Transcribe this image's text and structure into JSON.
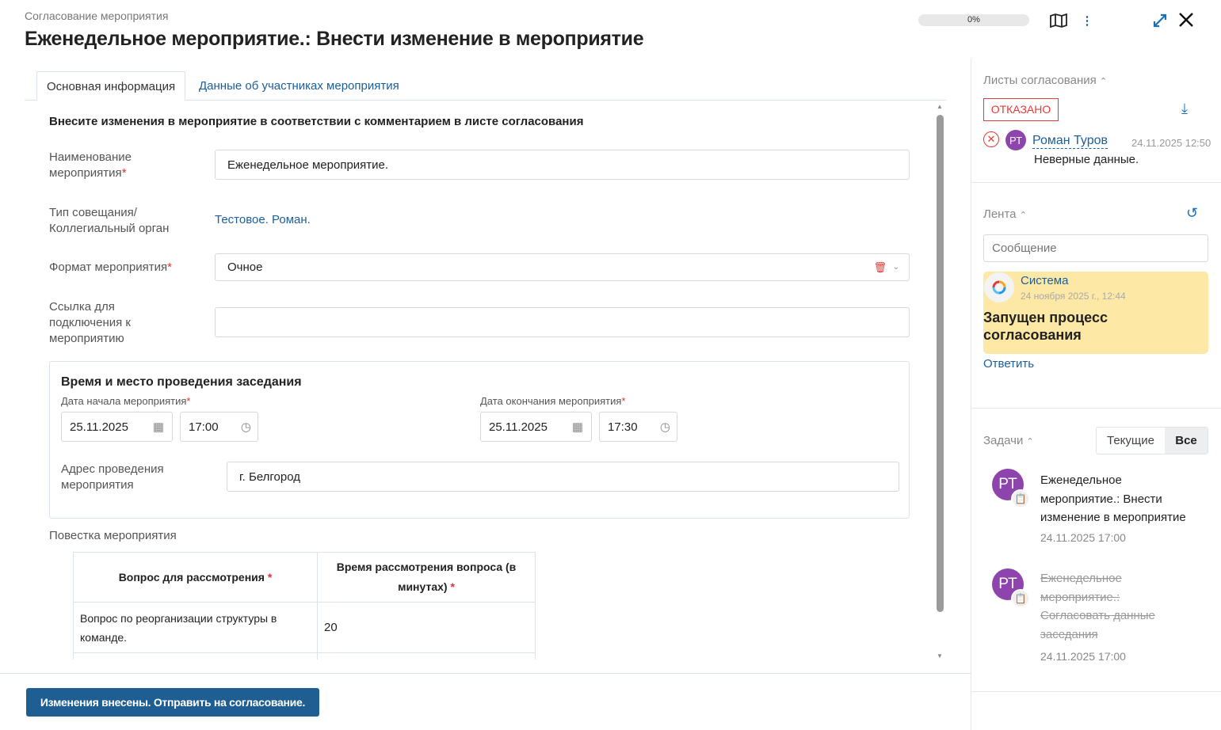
{
  "header": {
    "subtitle": "Согласование мероприятия",
    "title": "Еженедельное мероприятие.: Внести изменение в мероприятие",
    "progress": "0%"
  },
  "tabs": [
    {
      "label": "Основная информация"
    },
    {
      "label": "Данные об участниках мероприятия"
    }
  ],
  "form": {
    "instruction": "Внесите изменения в мероприятие в соответствии с комментарием в листе согласования",
    "name_label": "Наименование мероприятия",
    "name_value": "Еженедельное мероприятие.",
    "type_label": "Тип совещания/ Коллегиальный орган",
    "type_value": "Тестовое. Роман.",
    "format_label": "Формат мероприятия",
    "format_value": "Очное",
    "link_label": "Ссылка для подключения к мероприятию",
    "link_value": "",
    "time_section": "Время и место проведения заседания",
    "start_label": "Дата начала мероприятия",
    "start_date": "25.11.2025",
    "start_time": "17:00",
    "end_label": "Дата окончания мероприятия",
    "end_date": "25.11.2025",
    "end_time": "17:30",
    "address_label": "Адрес проведения мероприятия",
    "address_value": "г. Белгород",
    "agenda_label": "Повестка мероприятия",
    "agenda_headers": [
      "Вопрос для рассмотрения",
      "Время рассмотрения вопроса (в минутах)"
    ],
    "agenda_rows": [
      {
        "question": "Вопрос по реорганизации структуры в команде.",
        "minutes": "20"
      }
    ],
    "required_mark": "*"
  },
  "footer": {
    "submit": "Изменения внесены. Отправить на согласование."
  },
  "sidebar": {
    "approval": {
      "title": "Листы согласования",
      "status": "ОТКАЗАНО",
      "avatar": "РТ",
      "user": "Роман Туров",
      "date": "24.11.2025 12:50",
      "comment": "Неверные данные."
    },
    "feed": {
      "title": "Лента",
      "placeholder": "Сообщение",
      "author": "Система",
      "date": "24 ноября 2025 г., 12:44",
      "message": "Запущен процесс согласования",
      "reply": "Ответить"
    },
    "tasks": {
      "title": "Задачи",
      "filter_current": "Текущие",
      "filter_all": "Все",
      "items": [
        {
          "avatar": "РТ",
          "title": "Еженедельное мероприятие.: Внести изменение в мероприятие",
          "date": "24.11.2025 17:00"
        },
        {
          "avatar": "РТ",
          "title": "Еженедельное мероприятие.: Согласовать данные заседания",
          "date": "24.11.2025 17:00"
        }
      ]
    }
  },
  "colors": {
    "accent": "#1f5e93",
    "link": "#1a5f9e",
    "rejected": "#e53935",
    "feed_bg": "#fde8a6",
    "avatar": "#8e44ad"
  }
}
